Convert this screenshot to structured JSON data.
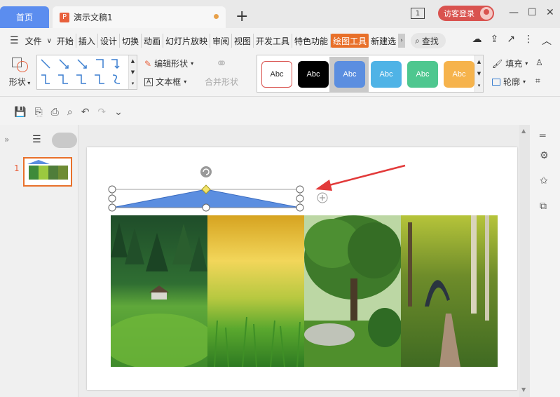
{
  "tabs": {
    "home": "首页",
    "doc_title": "演示文稿1",
    "doc_icon": "P",
    "new_tab": "+"
  },
  "window": {
    "count": "1",
    "login": "访客登录"
  },
  "menu": {
    "file": "文件",
    "items": [
      "开始",
      "插入",
      "设计",
      "切换",
      "动画",
      "幻灯片放映",
      "审阅",
      "视图",
      "开发工具",
      "特色功能",
      "绘图工具",
      "新建选"
    ],
    "active_index": 10,
    "search": "查找"
  },
  "ribbon": {
    "shape": "形状",
    "edit_shape": "编辑形状",
    "text_box": "文本框",
    "merge_shape": "合并形状",
    "style_label": "Abc",
    "fill": "填充",
    "outline": "轮廓"
  },
  "thumbnail": {
    "number": "1"
  },
  "colors": {
    "accent": "#e8702a",
    "home_tab": "#5b8def",
    "login": "#d9534f",
    "shape_fill": "#5b8ee0",
    "arrow": "#e23a3a"
  },
  "icons": [
    "menu-icon",
    "search-icon",
    "cloud-icon",
    "share-icon",
    "more-icon",
    "collapse-icon",
    "save-icon",
    "undo-icon",
    "redo-icon",
    "print-icon"
  ]
}
